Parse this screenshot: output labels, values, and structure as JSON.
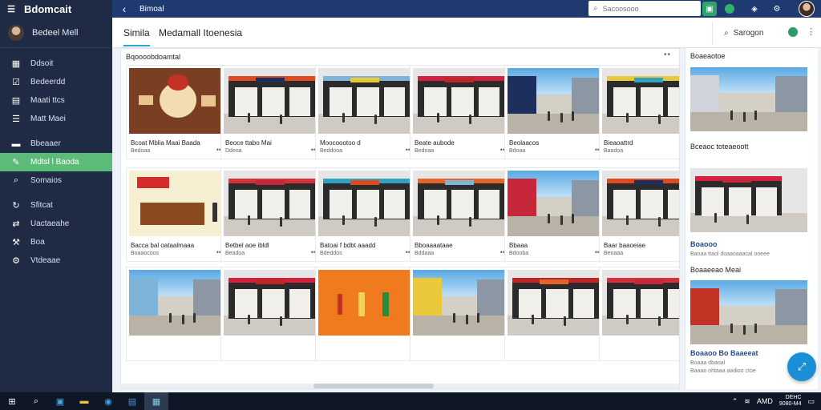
{
  "app": {
    "brand": "Bdomcait",
    "menu_icon": "hamburger-icon"
  },
  "sidebar": {
    "user": "Bedeel Mell",
    "items": [
      {
        "label": "Ddsoit",
        "icon": "grid-icon"
      },
      {
        "label": "Bedeerdd",
        "icon": "checkbox-icon"
      },
      {
        "label": "Maati ttcs",
        "icon": "document-icon"
      },
      {
        "label": "Matt Maei",
        "icon": "list-icon"
      },
      {
        "label": "Bbeaaer",
        "icon": "card-icon"
      },
      {
        "label": "Mdtsl l Baoda",
        "icon": "pen-icon",
        "active": true
      },
      {
        "label": "Somaios",
        "icon": "search-icon"
      },
      {
        "label": "Sfitcat",
        "icon": "refresh-icon"
      },
      {
        "label": "Uactaeahe",
        "icon": "sync-icon"
      },
      {
        "label": "Boa",
        "icon": "wrench-icon"
      },
      {
        "label": "Vtdeaae",
        "icon": "gear-icon"
      }
    ]
  },
  "topbar": {
    "title": "Bimoal",
    "search_placeholder": "Sacoosooo"
  },
  "header": {
    "tab": "Simila",
    "title": "Medamall Itoenesia",
    "share_label": "Sarogon"
  },
  "panel": {
    "section_label": "Bqoooobdoamtal",
    "cards": [
      {
        "title": "Bcoat Mblia Maai Baada",
        "meta": "Bedoaa",
        "scene": "food"
      },
      {
        "title": "Beoce ttabo Mai",
        "meta": "Ddeoa",
        "scene": "store-a"
      },
      {
        "title": "Moocoootoo d",
        "meta": "Beddooa",
        "scene": "store-b"
      },
      {
        "title": "Beate aubode",
        "meta": "Bedoaa",
        "scene": "store-c"
      },
      {
        "title": "Beolaacos",
        "meta": "Bdoaa",
        "scene": "street-a"
      },
      {
        "title": "Bieaoattrd",
        "meta": "Baadoa",
        "scene": "store-d"
      },
      {
        "title": "Bacca bal oataalmaaa",
        "meta": "Boaaocoos",
        "scene": "stall"
      },
      {
        "title": "Betbel aoe ibldl",
        "meta": "Beadoa",
        "scene": "store-e"
      },
      {
        "title": "Batoai f bdbt aaadd",
        "meta": "Bdeddos",
        "scene": "store-f"
      },
      {
        "title": "Bboaaaataae",
        "meta": "Bddaaa",
        "scene": "store-g"
      },
      {
        "title": "Bbaaa",
        "meta": "Bdooba",
        "scene": "street-b"
      },
      {
        "title": "Baar baaoeiae",
        "meta": "Beoaaa",
        "scene": "store-h"
      },
      {
        "title": "",
        "meta": "",
        "scene": "street-c"
      },
      {
        "title": "",
        "meta": "",
        "scene": "store-i"
      },
      {
        "title": "",
        "meta": "",
        "scene": "orange"
      },
      {
        "title": "",
        "meta": "",
        "scene": "street-d"
      },
      {
        "title": "",
        "meta": "",
        "scene": "store-j"
      },
      {
        "title": "",
        "meta": "",
        "scene": "store-k"
      }
    ]
  },
  "right_panel": {
    "header": "Boaeaotoe",
    "items": [
      {
        "title": "Bceaoc toteaeoott",
        "meta": ""
      },
      {
        "title": "Boaooo",
        "meta": "Baoaa ttaol doaaoaaacal ooeee"
      },
      {
        "title": "Boaaeeao Meai",
        "meta": ""
      },
      {
        "title": "Boaaoo Bo Baaeeat",
        "meta": "Boaaa dbaoal"
      }
    ],
    "extra_meta": "Baaao ohtaaa aadioo ctoe"
  },
  "taskbar": {
    "time": "DEHC",
    "date": "9080-M4",
    "tray_text": "AMD"
  },
  "colors": {
    "sidebar": "#1f2a44",
    "active_item": "#5dbb7a",
    "topbar": "#1f3a70",
    "accent": "#2aa8c9",
    "fab": "#1b8fd6"
  }
}
